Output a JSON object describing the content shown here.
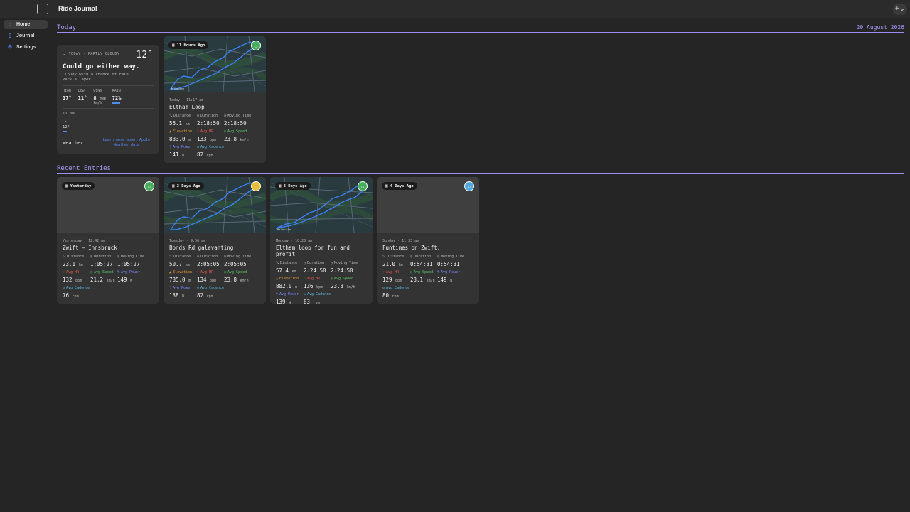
{
  "app": {
    "title": "Ride Journal"
  },
  "toolbar": {
    "add_label": "+⌄"
  },
  "sidebar": {
    "items": [
      {
        "label": "Home",
        "icon": "house-icon"
      },
      {
        "label": "Journal",
        "icon": "book-icon"
      },
      {
        "label": "Settings",
        "icon": "gear-icon"
      }
    ]
  },
  "today": {
    "title": "Today",
    "date": "20 August 2026"
  },
  "recent": {
    "title": "Recent Entries"
  },
  "weather": {
    "header": "TODAY · PARTLY CLOUDY",
    "temp": "12°",
    "headline": "Could go either way.",
    "summary": "Cloudy with a chance of rain. Pack a layer.",
    "high_label": "HIGH",
    "high": "17°",
    "low_label": "LOW",
    "low": "11°",
    "wind_label": "WIND",
    "wind": "8",
    "wind_dir": "WNW",
    "wind_unit": "km/h",
    "rain_label": "RAIN",
    "rain": "72%",
    "hour_time": "11 pm",
    "hour_temp": "12°",
    "brand": "Weather",
    "learn_more": "Learn more about Apple Weather data",
    "accent_color": "#4f8df5"
  },
  "labels": {
    "distance": "Distance",
    "duration": "Duration",
    "moving_time": "Moving Time",
    "elevation": "Elevation",
    "avg_hr": "Avg HR",
    "avg_speed": "Avg Speed",
    "avg_power": "Avg Power",
    "avg_cadence": "Avg Cadence",
    "km": "km",
    "m": "m",
    "bpm": "bpm",
    "kmh": "km/h",
    "w": "W",
    "rpm": "rpm"
  },
  "rides": [
    {
      "badge": "11 Hours Ago",
      "mood": "green",
      "has_map": true,
      "map_city": "Melbourne",
      "meta": "Today · 11:17 am",
      "title": "Eltham Loop",
      "distance": "56.1",
      "duration": "2:18:50",
      "moving_time": "2:18:50",
      "elevation": "883.0",
      "avg_hr": "133",
      "avg_speed": "23.8",
      "avg_power": "141",
      "avg_cadence": "82"
    },
    {
      "badge": "Yesterday",
      "mood": "green",
      "has_map": false,
      "meta": "Yesterday · 12:42 pm",
      "title": "Zwift — Innsbruck",
      "distance": "23.1",
      "duration": "1:05:27",
      "moving_time": "1:05:27",
      "avg_hr": "132",
      "avg_speed": "21.2",
      "avg_power": "149",
      "avg_cadence": "76"
    },
    {
      "badge": "2 Days Ago",
      "mood": "yellow",
      "has_map": true,
      "meta": "Tuesday · 9:56 am",
      "title": "Bonds Rd galevanting",
      "distance": "50.7",
      "duration": "2:05:05",
      "moving_time": "2:05:05",
      "elevation": "785.0",
      "avg_hr": "134",
      "avg_speed": "23.8",
      "avg_power": "138",
      "avg_cadence": "82"
    },
    {
      "badge": "3 Days Ago",
      "mood": "green",
      "has_map": true,
      "map_city": "Melbourne",
      "meta": "Monday · 10:28 am",
      "title": "Eltham loop for fun and profit",
      "distance": "57.4",
      "duration": "2:24:50",
      "moving_time": "2:24:50",
      "elevation": "882.0",
      "avg_hr": "136",
      "avg_speed": "23.3",
      "avg_power": "139",
      "avg_cadence": "83"
    },
    {
      "badge": "4 Days Ago",
      "mood": "blue",
      "has_map": false,
      "meta": "Sunday · 11:33 am",
      "title": "Funtimes on Zwift.",
      "distance": "21.0",
      "duration": "0:54:31",
      "moving_time": "0:54:31",
      "avg_hr": "129",
      "avg_speed": "23.1",
      "avg_power": "149",
      "avg_cadence": "80"
    }
  ]
}
